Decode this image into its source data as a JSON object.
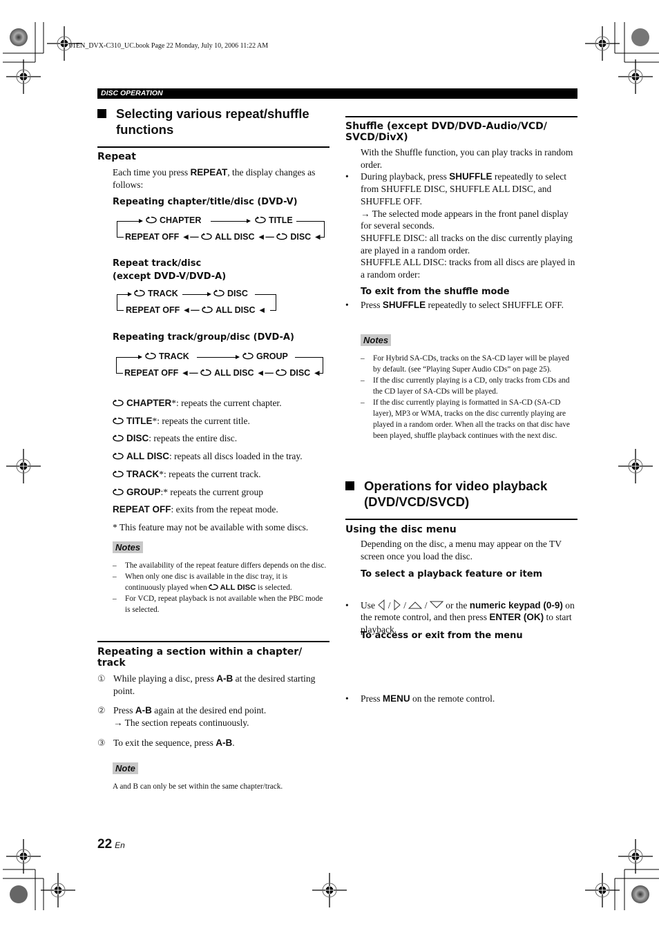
{
  "print_header": "01EN_DVX-C310_UC.book  Page 22  Monday, July 10, 2006  11:22 AM",
  "section_bar": "DISC OPERATION",
  "left": {
    "heading": "Selecting various repeat/shuffle functions",
    "repeat": {
      "title": "Repeat",
      "intro_pre": "Each time you press ",
      "intro_key": "REPEAT",
      "intro_post": ", the display changes as follows:",
      "diagram1": {
        "title": "Repeating chapter/title/disc (DVD-V)",
        "top": [
          "CHAPTER",
          "TITLE"
        ],
        "bottom": [
          "REPEAT OFF",
          "ALL DISC",
          "DISC"
        ]
      },
      "diagram2": {
        "title_line1": "Repeat track/disc",
        "title_line2": "(except DVD-V/DVD-A)",
        "top": [
          "TRACK",
          "DISC"
        ],
        "bottom": [
          "REPEAT OFF",
          "ALL DISC"
        ]
      },
      "diagram3": {
        "title": "Repeating track/group/disc (DVD-A)",
        "top": [
          "TRACK",
          "GROUP"
        ],
        "bottom": [
          "REPEAT OFF",
          "ALL DISC",
          "DISC"
        ]
      },
      "definitions": [
        {
          "key": "CHAPTER",
          "text": "*: repeats the current chapter.",
          "icon": true
        },
        {
          "key": "TITLE",
          "text": "*: repeats the current title.",
          "icon": true
        },
        {
          "key": "DISC",
          "text": ": repeats the entire disc.",
          "icon": true
        },
        {
          "key": "ALL DISC",
          "text": ": repeats all discs loaded in the tray.",
          "icon": true
        },
        {
          "key": "TRACK",
          "text": "*: repeats the current track.",
          "icon": true
        },
        {
          "key": "GROUP",
          "text": ":* repeats the current group",
          "icon": true
        },
        {
          "key": "REPEAT OFF",
          "text": ": exits from the repeat mode.",
          "icon": false
        }
      ],
      "footnote": "* This feature may not be available with some discs.",
      "notes_label": "Notes",
      "notes": [
        "The availability of the repeat feature differs depends on the disc.",
        "When only one disc is available in the disc tray, it is continuously played when",
        "For VCD, repeat playback is not available when the PBC mode is selected."
      ],
      "note2_key": "ALL DISC",
      "note2_post": " is selected."
    },
    "ab": {
      "title": "Repeating a section within a chapter/ track",
      "steps": [
        {
          "n": "①",
          "pre": "While playing a disc, press ",
          "key": "A-B",
          "post": " at the desired starting point."
        },
        {
          "n": "②",
          "pre": "Press ",
          "key": "A-B",
          "post": " again at the desired end point.",
          "result": "→ The section repeats continuously."
        },
        {
          "n": "③",
          "pre": "To exit the sequence, press ",
          "key": "A-B",
          "post": "."
        }
      ],
      "note_label": "Note",
      "note": "A and B can only be set within the same chapter/track."
    }
  },
  "right": {
    "shuffle": {
      "title": "Shuffle (except DVD/DVD-Audio/VCD/ SVCD/DivX)",
      "intro": "With the Shuffle function, you can play tracks in random order.",
      "bullet_pre": "During playback, press ",
      "bullet_key": "SHUFFLE",
      "bullet_post": " repeatedly to select from SHUFFLE DISC, SHUFFLE ALL DISC, and SHUFFLE OFF.",
      "result": "→ The selected mode appears in the front panel display for several seconds.",
      "disc_desc": "SHUFFLE DISC: all tracks on the disc currently playing are played in a random order.",
      "all_desc": "SHUFFLE ALL DISC: tracks from all discs are played in a random order:",
      "exit_title": "To exit from the shuffle mode",
      "exit_pre": " Press ",
      "exit_key": "SHUFFLE",
      "exit_post": " repeatedly to select SHUFFLE OFF.",
      "notes_label": "Notes",
      "notes": [
        "For Hybrid SA-CDs, tracks on the SA-CD layer will be played by default. (see “Playing Super Audio CDs” on page 25).",
        "If the disc currently playing is a CD, only tracks from CDs and the CD layer of SA-CDs will be played.",
        "If the disc currently playing is formatted in SA-CD (SA-CD layer), MP3 or WMA, tracks on the disc currently playing are played in a random order. When all the tracks on that disc have been played, shuffle playback continues with the next disc."
      ]
    },
    "video": {
      "heading": "Operations for video playback (DVD/VCD/SVCD)",
      "menu_title": "Using the disc menu",
      "menu_intro": "Depending on the disc, a menu may appear on the TV screen once you load the disc.",
      "select_title": "To select a playback feature or item",
      "select_pre": "Use ",
      "select_mid": " or the ",
      "select_key1": "numeric keypad (0-9)",
      "select_mid2": " on the remote control, and then press ",
      "select_key2": "ENTER (OK)",
      "select_post": " to start playback.",
      "access_title": "To access or exit from the menu",
      "access_pre": "Press ",
      "access_key": "MENU",
      "access_post": " on the remote control."
    }
  },
  "footer": {
    "page_number": "22",
    "lang": "En"
  }
}
